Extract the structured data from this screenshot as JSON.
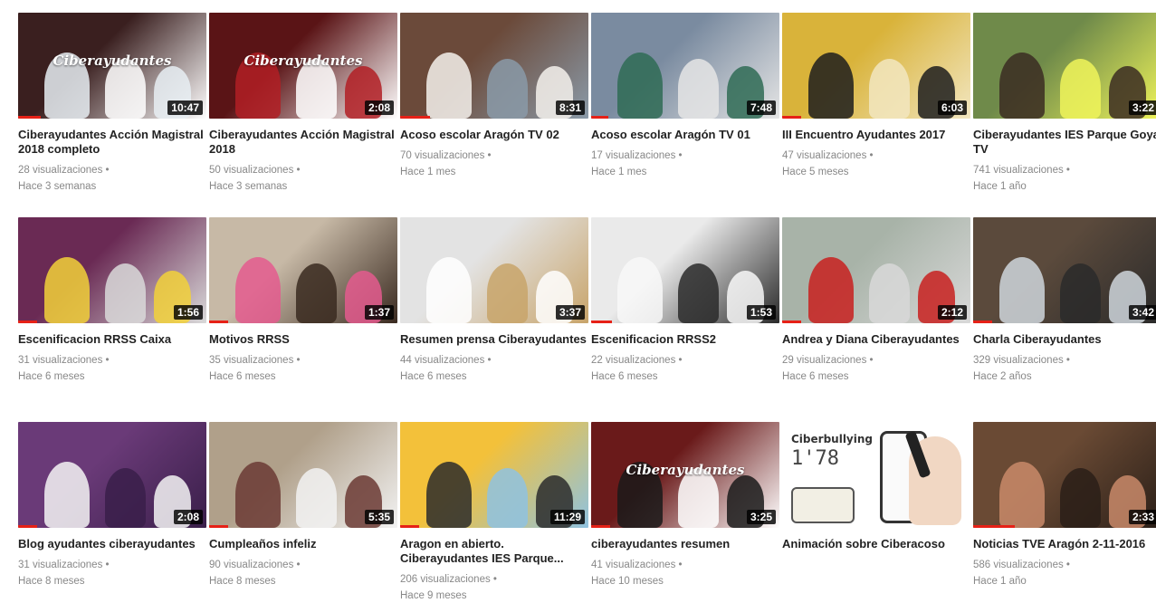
{
  "videos": [
    {
      "title": "Ciberayudantes Acción Magistral 2018 completo",
      "views": "28 visualizaciones",
      "age": "Hace 3 semanas",
      "duration": "10:47",
      "progress": 0.12,
      "colors": [
        "#3a1f1f",
        "#e8eef3",
        "#ffffff"
      ],
      "overlay": "Ciberayudantes"
    },
    {
      "title": "Ciberayudantes Acción Magistral 2018",
      "views": "50 visualizaciones",
      "age": "Hace 3 semanas",
      "duration": "2:08",
      "progress": 0.0,
      "colors": [
        "#5a1416",
        "#b21f25",
        "#ffffff"
      ],
      "overlay": "Ciberayudantes"
    },
    {
      "title": "Acoso escolar Aragón TV 02",
      "views": "70 visualizaciones",
      "age": "Hace 1 mes",
      "duration": "8:31",
      "progress": 0.16,
      "colors": [
        "#6b4a3a",
        "#f5f1ec",
        "#8a9aa8"
      ],
      "overlay": ""
    },
    {
      "title": "Acoso escolar Aragón TV 01",
      "views": "17 visualizaciones",
      "age": "Hace 1 mes",
      "duration": "7:48",
      "progress": 0.09,
      "colors": [
        "#7a8ba0",
        "#2f6b55",
        "#e5e5e5"
      ],
      "overlay": ""
    },
    {
      "title": "III Encuentro Ayudantes 2017",
      "views": "47 visualizaciones",
      "age": "Hace 5 meses",
      "duration": "6:03",
      "progress": 0.1,
      "colors": [
        "#d9b33a",
        "#1d1d1d",
        "#f2e6c0"
      ],
      "overlay": ""
    },
    {
      "title": "Ciberayudantes IES Parque Goya TV",
      "views": "741 visualizaciones",
      "age": "Hace 1 año",
      "duration": "3:22",
      "progress": 0.0,
      "colors": [
        "#6f8a4a",
        "#3b2b22",
        "#f0f55a"
      ],
      "overlay": ""
    },
    {
      "title": "Escenificacion RRSS Caixa",
      "views": "31 visualizaciones",
      "age": "Hace 6 meses",
      "duration": "1:56",
      "progress": 0.1,
      "colors": [
        "#6a2a54",
        "#f2d13a",
        "#d9d9d9"
      ],
      "overlay": ""
    },
    {
      "title": "Motivos RRSS",
      "views": "35 visualizaciones",
      "age": "Hace 6 meses",
      "duration": "1:37",
      "progress": 0.1,
      "colors": [
        "#c7b9a6",
        "#e45a8e",
        "#3a2a20"
      ],
      "overlay": ""
    },
    {
      "title": "Resumen prensa Ciberayudantes",
      "views": "44 visualizaciones",
      "age": "Hace 6 meses",
      "duration": "3:37",
      "progress": 0.0,
      "colors": [
        "#e3e3e3",
        "#ffffff",
        "#c8a46a"
      ],
      "overlay": ""
    },
    {
      "title": "Escenificacion RRSS2",
      "views": "22 visualizaciones",
      "age": "Hace 6 meses",
      "duration": "1:53",
      "progress": 0.11,
      "colors": [
        "#eaeaea",
        "#f8f8f8",
        "#2a2a2a"
      ],
      "overlay": ""
    },
    {
      "title": "Andrea y Diana Ciberayudantes",
      "views": "29 visualizaciones",
      "age": "Hace 6 meses",
      "duration": "2:12",
      "progress": 0.1,
      "colors": [
        "#a8b3a8",
        "#c8201f",
        "#d8d8d8"
      ],
      "overlay": ""
    },
    {
      "title": "Charla Ciberayudantes",
      "views": "329 visualizaciones",
      "age": "Hace 2 años",
      "duration": "3:42",
      "progress": 0.1,
      "colors": [
        "#5b4a3c",
        "#cfd6dc",
        "#2a2a2a"
      ],
      "overlay": ""
    },
    {
      "title": "Blog ayudantes ciberayudantes",
      "views": "31 visualizaciones",
      "age": "Hace 8 meses",
      "duration": "2:08",
      "progress": 0.1,
      "colors": [
        "#6a3a78",
        "#f4f4f4",
        "#3a1f4a"
      ],
      "overlay": ""
    },
    {
      "title": "Cumpleaños infeliz",
      "views": "90 visualizaciones",
      "age": "Hace 8 meses",
      "duration": "5:35",
      "progress": 0.1,
      "colors": [
        "#b0a08a",
        "#6b3a34",
        "#f2f2f2"
      ],
      "overlay": ""
    },
    {
      "title": "Aragon en abierto. Ciberayudantes IES Parque...",
      "views": "206 visualizaciones",
      "age": "Hace 9 meses",
      "duration": "11:29",
      "progress": 0.1,
      "colors": [
        "#f3c13a",
        "#2b2b2b",
        "#8fc2e0"
      ],
      "overlay": ""
    },
    {
      "title": "ciberayudantes resumen",
      "views": "41 visualizaciones",
      "age": "Hace 10 meses",
      "duration": "3:25",
      "progress": 0.1,
      "colors": [
        "#6a1a1a",
        "#1a1a1a",
        "#ffffff"
      ],
      "overlay": "Ciberayudantes"
    },
    {
      "title": "Animación sobre Ciberacoso",
      "views": "",
      "age": "",
      "duration": "",
      "progress": 0.0,
      "colors": [
        "#ffffff",
        "#333333",
        "#f1d7c3"
      ],
      "overlay": "",
      "special": true,
      "special_text": "Ciberbullying",
      "special_num": "1'78"
    },
    {
      "title": "Noticias TVE Aragón 2-11-2016",
      "views": "586 visualizaciones",
      "age": "Hace 1 año",
      "duration": "2:33",
      "progress": 0.22,
      "colors": [
        "#6a4a34",
        "#c98a6a",
        "#2a1f18"
      ],
      "overlay": ""
    }
  ]
}
